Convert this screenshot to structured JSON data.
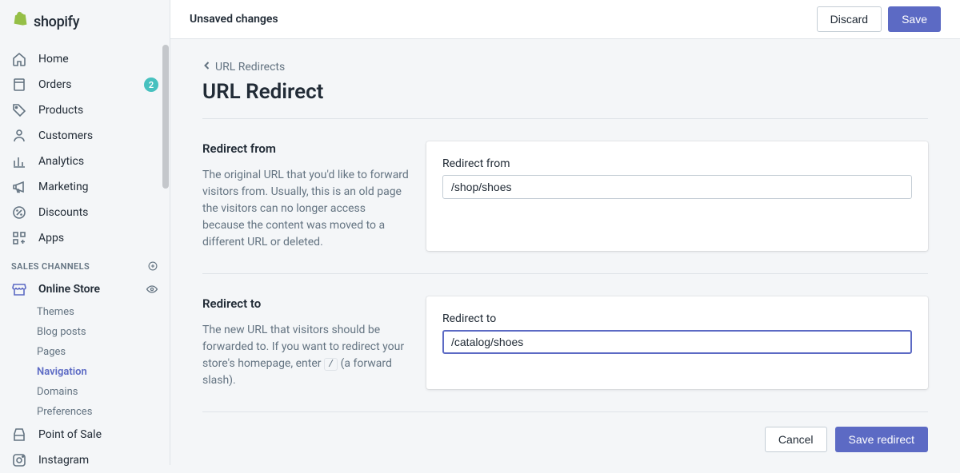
{
  "logo_text": "shopify",
  "topbar": {
    "title": "Unsaved changes",
    "discard": "Discard",
    "save": "Save"
  },
  "nav": {
    "home": "Home",
    "orders": "Orders",
    "orders_badge": "2",
    "products": "Products",
    "customers": "Customers",
    "analytics": "Analytics",
    "marketing": "Marketing",
    "discounts": "Discounts",
    "apps": "Apps"
  },
  "section_header": "SALES CHANNELS",
  "channels": {
    "online_store": "Online Store",
    "themes": "Themes",
    "blog_posts": "Blog posts",
    "pages": "Pages",
    "navigation": "Navigation",
    "domains": "Domains",
    "preferences": "Preferences",
    "pos": "Point of Sale",
    "instagram": "Instagram"
  },
  "breadcrumb": "URL Redirects",
  "page_title": "URL Redirect",
  "redirect_from": {
    "title": "Redirect from",
    "desc": "The original URL that you'd like to forward visitors from. Usually, this is an old page the visitors can no longer access because the content was moved to a different URL or deleted.",
    "label": "Redirect from",
    "value": "/shop/shoes"
  },
  "redirect_to": {
    "title": "Redirect to",
    "desc_before": "The new URL that visitors should be forwarded to. If you want to redirect your store's homepage, enter ",
    "desc_code": "/",
    "desc_after": " (a forward slash).",
    "label": "Redirect to",
    "value": "/catalog/shoes"
  },
  "footer": {
    "cancel": "Cancel",
    "save": "Save redirect"
  }
}
